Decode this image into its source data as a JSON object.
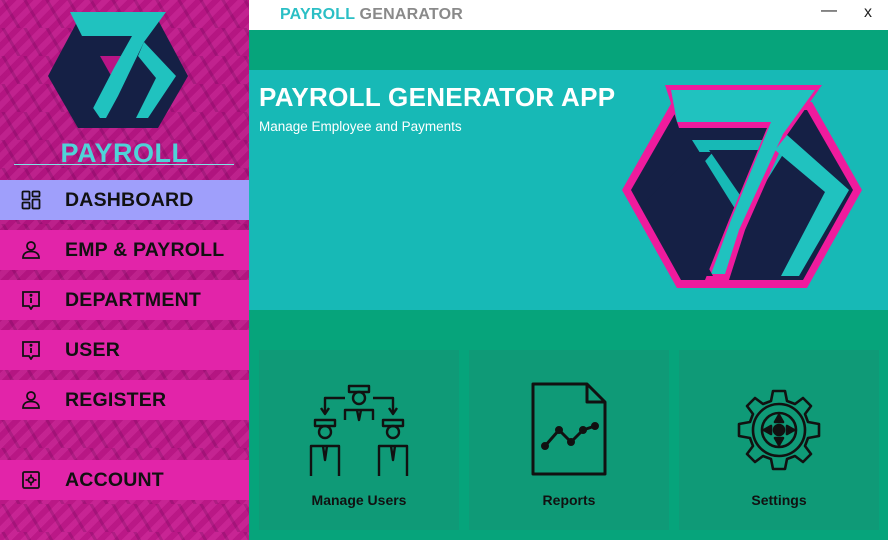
{
  "window": {
    "title_part1": "PAYROLL",
    "title_part2": " GENARATOR",
    "minimize": "—",
    "close": "x"
  },
  "sidebar": {
    "brand": "PAYROLL",
    "items": [
      {
        "label": "DASHBOARD",
        "icon": "dashboard-icon",
        "active": true
      },
      {
        "label": "EMP & PAYROLL",
        "icon": "person-icon"
      },
      {
        "label": "DEPARTMENT",
        "icon": "info-icon"
      },
      {
        "label": "USER",
        "icon": "info-icon"
      },
      {
        "label": "REGISTER",
        "icon": "person-icon"
      },
      {
        "label": "ACCOUNT",
        "icon": "gear-box-icon"
      }
    ]
  },
  "banner": {
    "title": "PAYROLL GENERATOR APP",
    "subtitle": "Manage Employee and Payments"
  },
  "cards": [
    {
      "label": "Manage Users",
      "icon": "manage-users-icon"
    },
    {
      "label": "Reports",
      "icon": "report-chart-icon"
    },
    {
      "label": "Settings",
      "icon": "settings-gear-icon"
    }
  ],
  "colors": {
    "sidebar": "#c0178a",
    "nav_item": "#e224a9",
    "nav_active": "#9f9ffb",
    "main_green": "#06a47b",
    "banner_teal": "#17b9b6",
    "card": "#0f9a77",
    "brand_teal": "#4fd3d8",
    "logo_navy": "#152045",
    "logo_pink": "#ef1b9d"
  }
}
